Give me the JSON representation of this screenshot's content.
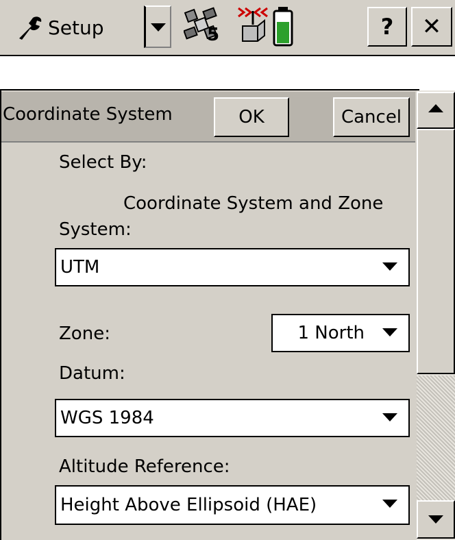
{
  "topbar": {
    "app_label": "Setup",
    "satellite_count": "5",
    "help_label": "?",
    "close_label": "✕"
  },
  "form": {
    "title": "Coordinate System",
    "ok_label": "OK",
    "cancel_label": "Cancel",
    "select_by_label": "Select By:",
    "select_by_value": "Coordinate System and Zone",
    "system_label": "System:",
    "system_value": "UTM",
    "zone_label": "Zone:",
    "zone_value": "1 North",
    "datum_label": "Datum:",
    "datum_value": "WGS 1984",
    "altitude_label": "Altitude Reference:",
    "altitude_value": "Height Above Ellipsoid (HAE)"
  },
  "icons": [
    "wrench-icon",
    "dropdown-arrow-icon",
    "satellite-icon",
    "radio-icon",
    "battery-icon",
    "scroll-up-icon",
    "scroll-down-icon"
  ],
  "colors": {
    "window_bg": "#d4d0c8",
    "header_bg": "#b8b4ac",
    "field_bg": "#ffffff",
    "battery_fill": "#2ca02c"
  }
}
